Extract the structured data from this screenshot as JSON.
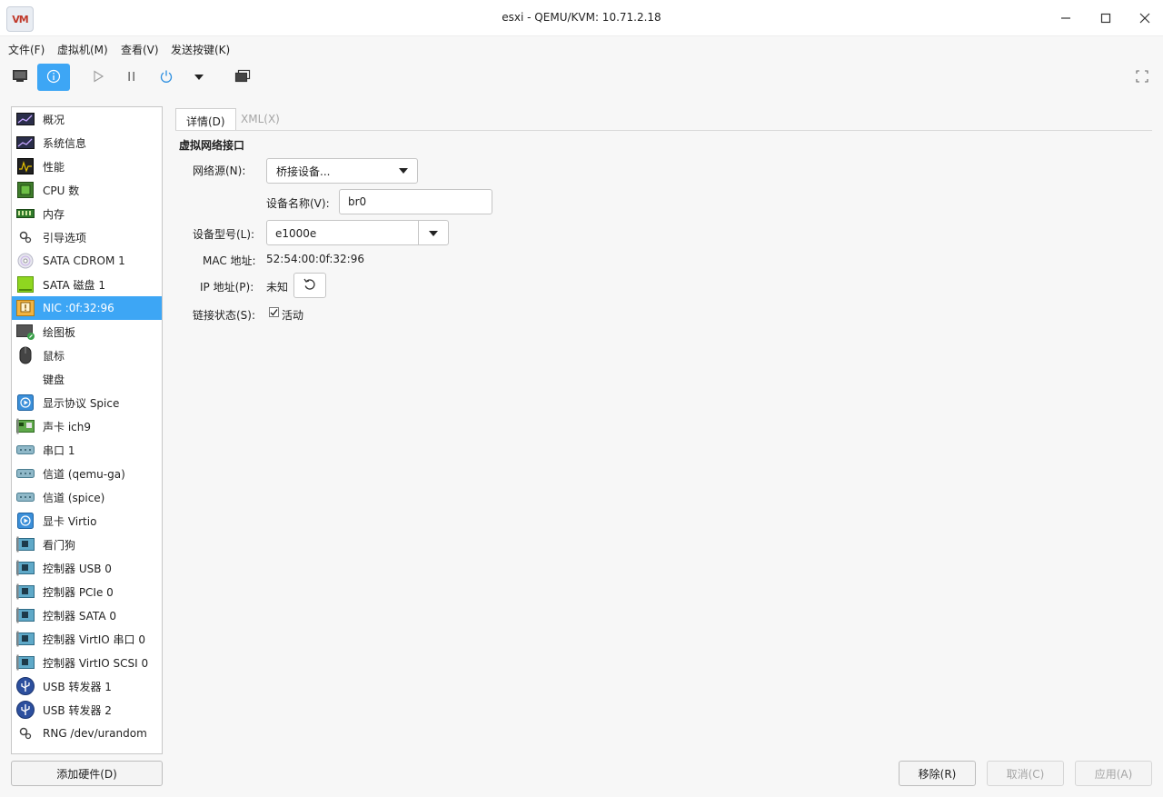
{
  "window": {
    "title": "esxi - QEMU/KVM: 10.71.2.18",
    "app_logo": "VM"
  },
  "menu": [
    "文件(F)",
    "虚拟机(M)",
    "查看(V)",
    "发送按键(K)"
  ],
  "sidebar": {
    "items": [
      {
        "label": "概况",
        "icon": "overview-icon"
      },
      {
        "label": "系统信息",
        "icon": "sysinfo-icon"
      },
      {
        "label": "性能",
        "icon": "performance-icon"
      },
      {
        "label": "CPU 数",
        "icon": "cpu-icon"
      },
      {
        "label": "内存",
        "icon": "memory-icon"
      },
      {
        "label": "引导选项",
        "icon": "boot-options-icon"
      },
      {
        "label": "SATA CDROM 1",
        "icon": "cdrom-icon"
      },
      {
        "label": "SATA 磁盘 1",
        "icon": "disk-icon"
      },
      {
        "label": "NIC :0f:32:96",
        "icon": "nic-icon"
      },
      {
        "label": "绘图板",
        "icon": "tablet-icon"
      },
      {
        "label": "鼠标",
        "icon": "mouse-icon"
      },
      {
        "label": "键盘",
        "icon": "keyboard-icon"
      },
      {
        "label": "显示协议 Spice",
        "icon": "display-icon"
      },
      {
        "label": "声卡 ich9",
        "icon": "sound-card-icon"
      },
      {
        "label": "串口 1",
        "icon": "serial-port-icon"
      },
      {
        "label": "信道 (qemu-ga)",
        "icon": "channel-icon"
      },
      {
        "label": "信道 (spice)",
        "icon": "channel-icon"
      },
      {
        "label": "显卡 Virtio",
        "icon": "video-card-icon"
      },
      {
        "label": "看门狗",
        "icon": "watchdog-icon"
      },
      {
        "label": "控制器 USB 0",
        "icon": "controller-icon"
      },
      {
        "label": "控制器 PCIe 0",
        "icon": "controller-icon"
      },
      {
        "label": "控制器 SATA 0",
        "icon": "controller-icon"
      },
      {
        "label": "控制器 VirtIO 串口 0",
        "icon": "controller-icon"
      },
      {
        "label": "控制器 VirtIO SCSI 0",
        "icon": "controller-icon"
      },
      {
        "label": "USB 转发器 1",
        "icon": "usb-redirector-icon"
      },
      {
        "label": "USB 转发器 2",
        "icon": "usb-redirector-icon"
      },
      {
        "label": "RNG /dev/urandom",
        "icon": "rng-icon"
      }
    ],
    "selected_index": 8,
    "add_hardware": "添加硬件(D)"
  },
  "tabs": {
    "details": "详情(D)",
    "xml": "XML(X)"
  },
  "nic": {
    "section_title": "虚拟网络接口",
    "network_source_label": "网络源(N):",
    "network_source_value": "桥接设备...",
    "device_name_label": "设备名称(V):",
    "device_name_value": "br0",
    "device_model_label": "设备型号(L):",
    "device_model_value": "e1000e",
    "mac_label": "MAC 地址:",
    "mac_value": "52:54:00:0f:32:96",
    "ip_label": "IP 地址(P):",
    "ip_value": "未知",
    "link_state_label": "链接状态(S):",
    "link_state_value": "活动",
    "link_state_checked": true
  },
  "buttons": {
    "remove": "移除(R)",
    "cancel": "取消(C)",
    "apply": "应用(A)"
  },
  "colors": {
    "accent": "#3da6f5"
  }
}
